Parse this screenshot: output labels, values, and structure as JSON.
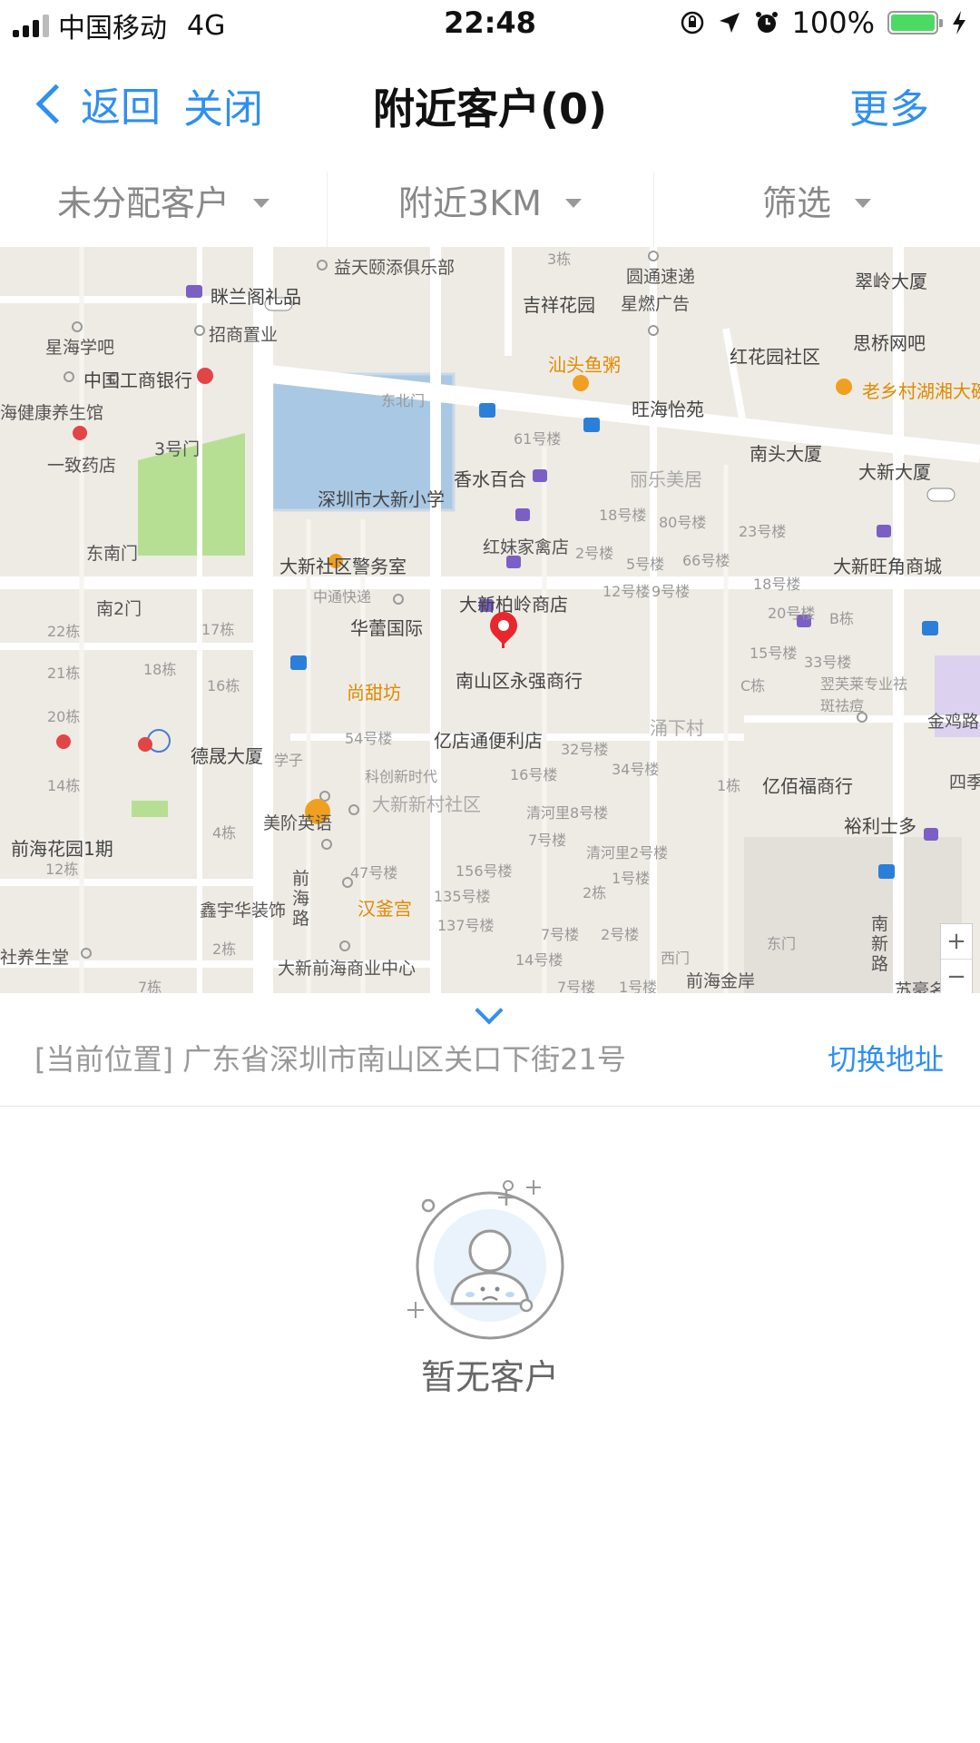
{
  "status_bar": {
    "carrier": "中国移动",
    "network": "4G",
    "time": "22:48",
    "battery": "100%",
    "battery_level": 1.0,
    "signal_bars": 3
  },
  "nav": {
    "back_label": "返回",
    "close_label": "关闭",
    "title": "附近客户(0)",
    "more_label": "更多"
  },
  "filters": [
    {
      "label": "未分配客户"
    },
    {
      "label": "附近3KM"
    },
    {
      "label": "筛选"
    }
  ],
  "map": {
    "labels": [
      "益天颐添俱乐部",
      "圆通速递",
      "翠岭大厦",
      "眯兰阁礼品",
      "吉祥花园",
      "星燃广告",
      "招商置业",
      "红花园社区",
      "思桥网吧",
      "星海学吧",
      "中国工商银行",
      "汕头鱼粥",
      "旺海怡苑",
      "老乡村湖湘大碗",
      "东北门",
      "海健康养生馆",
      "61号楼",
      "南头大厦",
      "大新大厦",
      "3号门",
      "一致药店",
      "深圳市大新小学",
      "香水百合",
      "丽乐美居",
      "红妹家禽店",
      "东南门",
      "大新社区警务室",
      "大新旺角商城",
      "中通快递",
      "大新柏岭商店",
      "南2门",
      "华蕾国际",
      "南山区永强商行",
      "尚甜坊",
      "翌芙莱专业祛斑祛痘",
      "金鸡路",
      "涌下村",
      "亿店通便利店",
      "德晟大厦",
      "亿佰福商行",
      "四季",
      "科创新时代",
      "大新新村社区",
      "前海花园1期",
      "美阶英语",
      "裕利士多",
      "汉釜宫",
      "前海路",
      "鑫宇华装饰",
      "南新路",
      "大新前海商业中心",
      "社养生堂",
      "西门",
      "东门",
      "前海金岸",
      "苏豪名"
    ],
    "building_labels": [
      "18号楼",
      "80号楼",
      "23号楼",
      "2号楼",
      "5号楼",
      "66号楼",
      "12号楼",
      "9号楼",
      "18号楼",
      "20号楼",
      "15号楼",
      "33号楼",
      "3栋",
      "22栋",
      "17栋",
      "21栋",
      "18栋",
      "16栋",
      "20栋",
      "54号楼",
      "32号楼",
      "34号楼",
      "16号楼",
      "14栋",
      "4栋",
      "清河里8号楼",
      "7号楼",
      "清河里2号楼",
      "47号楼",
      "156号楼",
      "1号楼",
      "135号楼",
      "2栋",
      "137号楼",
      "7号楼",
      "2号楼",
      "14号楼",
      "7号楼",
      "1号楼",
      "7栋",
      "12栋",
      "2栋",
      "B栋",
      "C栋",
      "1栋",
      "学子"
    ],
    "zoom_in": "+",
    "zoom_out": "−"
  },
  "location": {
    "current": "[当前位置] 广东省深圳市南山区关口下街21号",
    "switch_label": "切换地址"
  },
  "empty_state": {
    "text": "暂无客户"
  }
}
